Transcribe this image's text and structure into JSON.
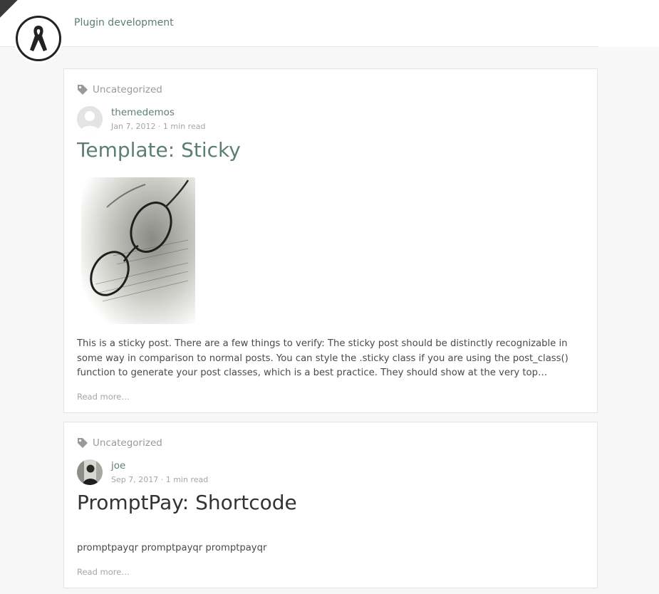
{
  "header": {
    "nav_link": "Plugin development",
    "badge_icon": "awareness-ribbon-icon",
    "sash_color": "#3a3a3a"
  },
  "colors": {
    "accent": "#5c8070",
    "muted": "#a5a5a5",
    "background": "#f7f7f7"
  },
  "posts": [
    {
      "category": "Uncategorized",
      "author": "themedemos",
      "meta": "Jan 7, 2012 · 1 min read",
      "title": "Template: Sticky",
      "image": "glasses-on-paper-photo",
      "excerpt": "This is a sticky post. There are a few things to verify: The sticky post should be distinctly recognizable in some way in comparison to normal posts. You can style the .sticky class if you are using the post_class() function to generate your post classes, which is a best practice. They should show at the very top…",
      "read_more": "Read more…"
    },
    {
      "category": "Uncategorized",
      "author": "joe",
      "meta": "Sep 7, 2017 · 1 min read",
      "title": "PromptPay: Shortcode",
      "excerpt": "promptpayqr promptpayqr promptpayqr",
      "read_more": "Read more…"
    }
  ]
}
